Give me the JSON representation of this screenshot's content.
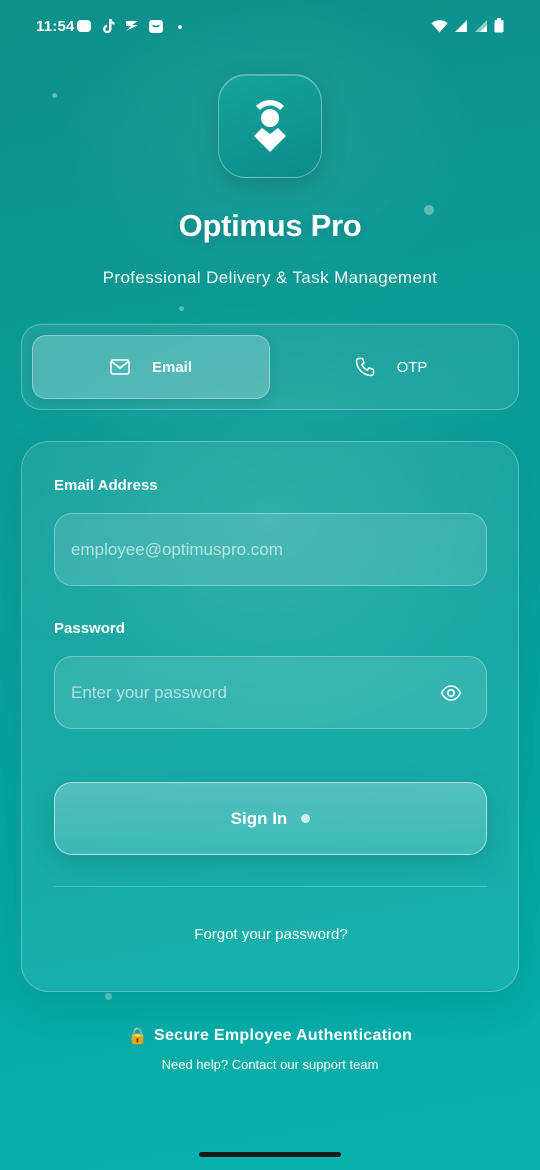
{
  "status_bar": {
    "time": "11:54",
    "notification_icons": [
      "messenger-icon",
      "tiktok-icon",
      "plane-icon",
      "shop-icon",
      "dot-icon"
    ],
    "right_icons": [
      "wifi-icon",
      "signal-icon",
      "signal-icon",
      "battery-icon"
    ]
  },
  "app": {
    "title": "Optimus Pro",
    "subtitle": "Professional Delivery & Task Management"
  },
  "tabs": [
    {
      "label": "Email",
      "icon": "mail-icon",
      "active": true
    },
    {
      "label": "OTP",
      "icon": "phone-icon",
      "active": false
    }
  ],
  "form": {
    "email_label": "Email Address",
    "email_placeholder": "employee@optimuspro.com",
    "password_label": "Password",
    "password_placeholder": "Enter your password",
    "sign_in_label": "Sign In",
    "forgot_label": "Forgot your password?"
  },
  "footer": {
    "secure_icon": "🔒",
    "secure_label": "Secure Employee Authentication",
    "help_label": "Need help? Contact our support team"
  },
  "colors": {
    "background_top": "#0e8f8a",
    "background_bottom": "#05b1ad",
    "text": "#ffffff"
  }
}
